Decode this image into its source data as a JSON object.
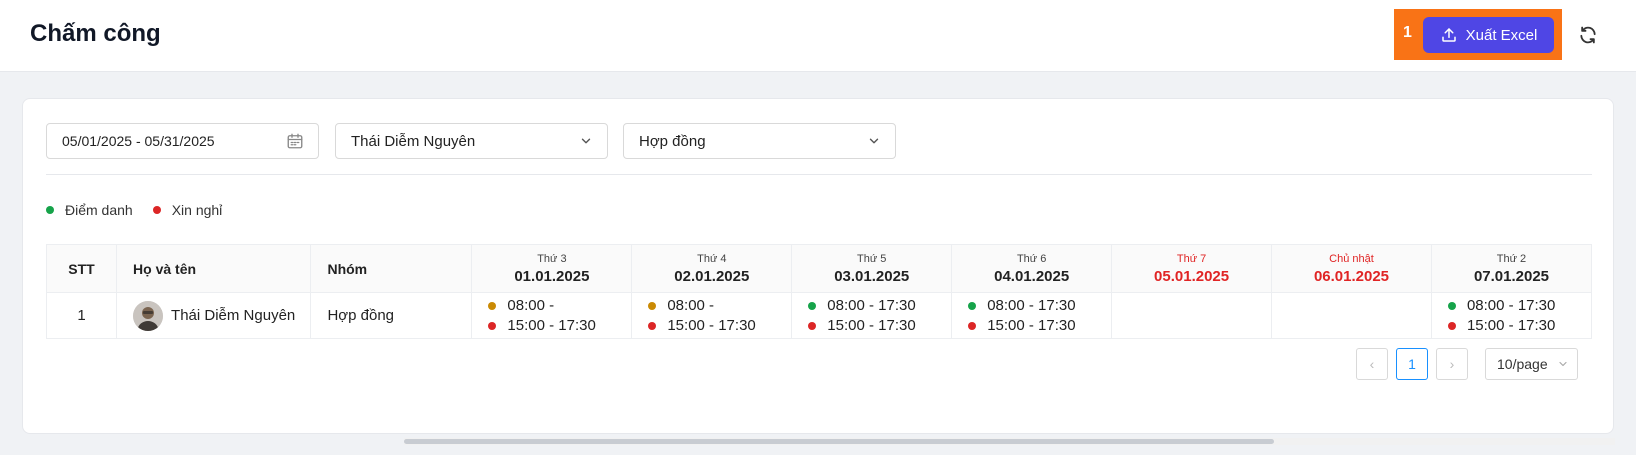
{
  "header": {
    "title": "Chấm công",
    "annotation_number": "1",
    "export_label": "Xuất Excel"
  },
  "filters": {
    "date_range": "05/01/2025 - 05/31/2025",
    "employee": "Thái Diễm Nguyên",
    "group": "Hợp đồng"
  },
  "legend": [
    {
      "label": "Điểm danh",
      "color": "#16a34a"
    },
    {
      "label": "Xin nghỉ",
      "color": "#dc2626"
    }
  ],
  "table": {
    "columns": {
      "stt": "STT",
      "name": "Họ và tên",
      "group": "Nhóm"
    },
    "days": [
      {
        "dow": "Thứ 3",
        "date": "01.01.2025",
        "weekend": false
      },
      {
        "dow": "Thứ 4",
        "date": "02.01.2025",
        "weekend": false
      },
      {
        "dow": "Thứ 5",
        "date": "03.01.2025",
        "weekend": false
      },
      {
        "dow": "Thứ 6",
        "date": "04.01.2025",
        "weekend": false
      },
      {
        "dow": "Thứ 7",
        "date": "05.01.2025",
        "weekend": true
      },
      {
        "dow": "Chủ nhật",
        "date": "06.01.2025",
        "weekend": true
      },
      {
        "dow": "Thứ 2",
        "date": "07.01.2025",
        "weekend": false
      }
    ],
    "rows": [
      {
        "stt": "1",
        "name": "Thái Diễm Nguyên",
        "group": "Hợp đồng",
        "days": [
          [
            {
              "color": "#ca8a04",
              "text": "08:00 -"
            },
            {
              "color": "#dc2626",
              "text": "15:00 - 17:30"
            }
          ],
          [
            {
              "color": "#ca8a04",
              "text": "08:00 -"
            },
            {
              "color": "#dc2626",
              "text": "15:00 - 17:30"
            }
          ],
          [
            {
              "color": "#16a34a",
              "text": "08:00 - 17:30"
            },
            {
              "color": "#dc2626",
              "text": "15:00 - 17:30"
            }
          ],
          [
            {
              "color": "#16a34a",
              "text": "08:00 - 17:30"
            },
            {
              "color": "#dc2626",
              "text": "15:00 - 17:30"
            }
          ],
          [],
          [],
          [
            {
              "color": "#16a34a",
              "text": "08:00 - 17:30"
            },
            {
              "color": "#dc2626",
              "text": "15:00 - 17:30"
            }
          ]
        ]
      }
    ]
  },
  "pagination": {
    "prev": "‹",
    "current": "1",
    "next": "›",
    "page_size": "10/page"
  }
}
